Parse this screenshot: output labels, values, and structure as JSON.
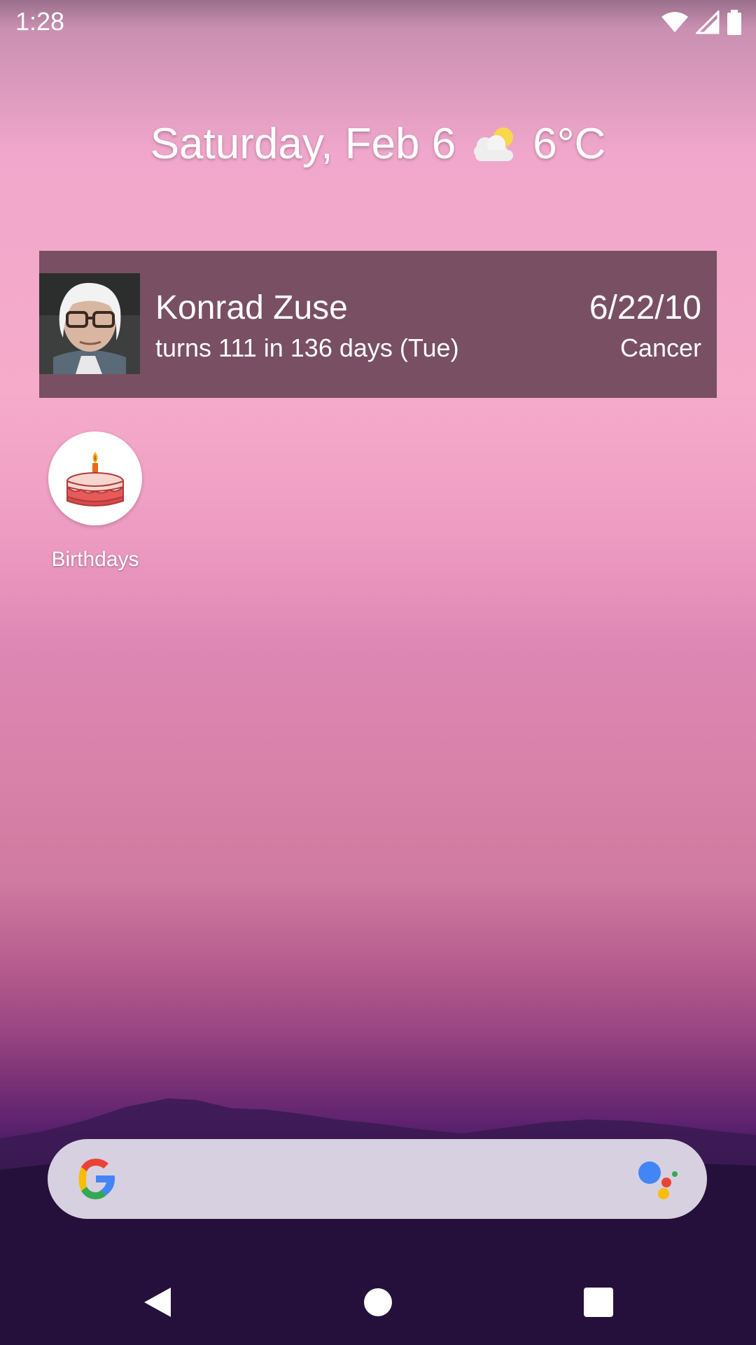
{
  "status_bar": {
    "time": "1:28",
    "icons": [
      "wifi-icon",
      "cell-signal-icon",
      "battery-icon"
    ]
  },
  "date_widget": {
    "date": "Saturday, Feb 6",
    "weather_icon": "partly-cloudy-icon",
    "temperature": "6°C"
  },
  "birthday_widget": {
    "name": "Konrad Zuse",
    "subtitle": "turns 111 in 136 days (Tue)",
    "birth_date": "6/22/10",
    "zodiac": "Cancer",
    "photo": "person-photo"
  },
  "apps": [
    {
      "label": "Birthdays",
      "icon": "birthday-cake-icon"
    }
  ],
  "search_bar": {
    "left_icon": "google-g-icon",
    "right_icon": "google-assistant-icon"
  },
  "nav_bar": {
    "buttons": [
      "back-icon",
      "home-icon",
      "recents-icon"
    ]
  },
  "colors": {
    "card_background": "#6e485a",
    "search_background": "#d7d0e0"
  }
}
